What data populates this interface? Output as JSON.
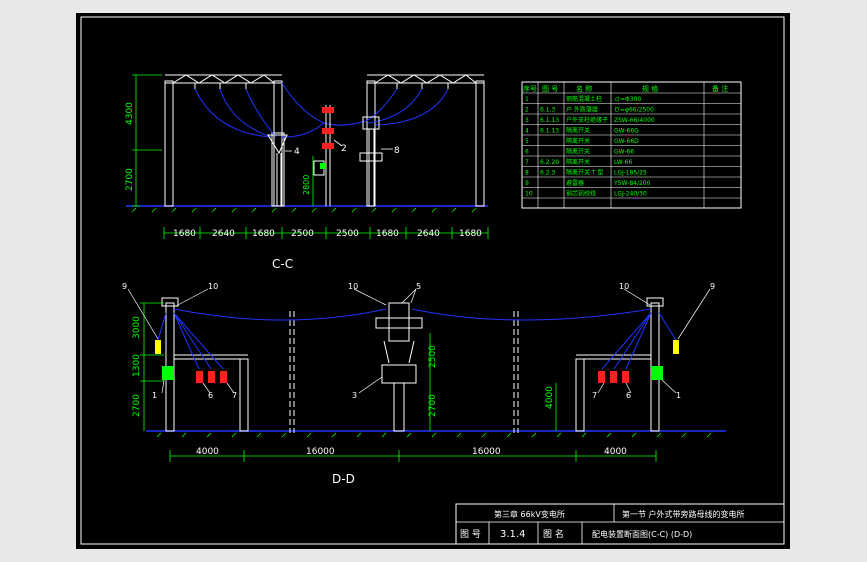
{
  "colors": {
    "background": "#e8e8e8",
    "canvas": "#000000",
    "frame": "#ffffff",
    "structure": "#ffffff",
    "dimension": "#00ff00",
    "conductor": "#2233ff",
    "ground": "#2233ff",
    "equipment_red": "#ff2020",
    "equipment_green": "#00ff00",
    "equipment_yellow": "#ffff00",
    "table_text": "#00ff00"
  },
  "view_cc": {
    "label": "C-C",
    "heights": [
      "4300",
      "2700",
      "2800"
    ],
    "spans": [
      "1680",
      "2640",
      "1680",
      "2500",
      "2500",
      "1680",
      "2640",
      "1680"
    ],
    "callouts": [
      "4",
      "2",
      "8"
    ]
  },
  "view_dd": {
    "label": "D-D",
    "heights_left": [
      "3000",
      "1300",
      "2700"
    ],
    "heights_mid": [
      "2500",
      "2700"
    ],
    "height_right": "4000",
    "spans": [
      "4000",
      "16000",
      "16000",
      "4000"
    ],
    "callouts": [
      "9",
      "10",
      "10",
      "5",
      "10",
      "9",
      "1",
      "6",
      "7",
      "3",
      "7",
      "6",
      "1"
    ]
  },
  "equipment_table": {
    "headers": [
      "序号",
      "图 号",
      "名  称",
      "规    格",
      "备 注"
    ],
    "rows": [
      [
        "1",
        "",
        "钢筋混凝土柱",
        "ｄ=Φ300",
        ""
      ],
      [
        "2",
        "6.1.3",
        "户 外跌落器",
        "Ｄ=φ66/2500",
        ""
      ],
      [
        "3",
        "6.1.13",
        "户外支柱绝缘子",
        "ZSW-66/4000",
        ""
      ],
      [
        "4",
        "6.1.13",
        "隔离开关",
        "GW-66G",
        ""
      ],
      [
        "5",
        "",
        "隔离开关",
        "GW-66D",
        ""
      ],
      [
        "6",
        "",
        "隔离开关",
        "GW-66",
        ""
      ],
      [
        "7",
        "6.2.20",
        "隔离开关",
        "LW-66",
        ""
      ],
      [
        "8",
        "6.2.3",
        "隔离开关 T 型",
        "LGJ-185/25",
        ""
      ],
      [
        "9",
        "",
        "避雷器",
        "Y5W-84/200",
        ""
      ],
      [
        "10",
        "",
        "钢芯铝绞线",
        "LGJ-240/30",
        ""
      ]
    ]
  },
  "title_block": {
    "chapter": "第三章  66kV变电所",
    "section": "第一节  户外式带旁路母线的变电所",
    "drawing_no_label": "图  号",
    "drawing_no": "3.1.4",
    "drawing_name_label": "图  名",
    "drawing_name": "配电装置断面图(C-C)  (D-D)"
  }
}
